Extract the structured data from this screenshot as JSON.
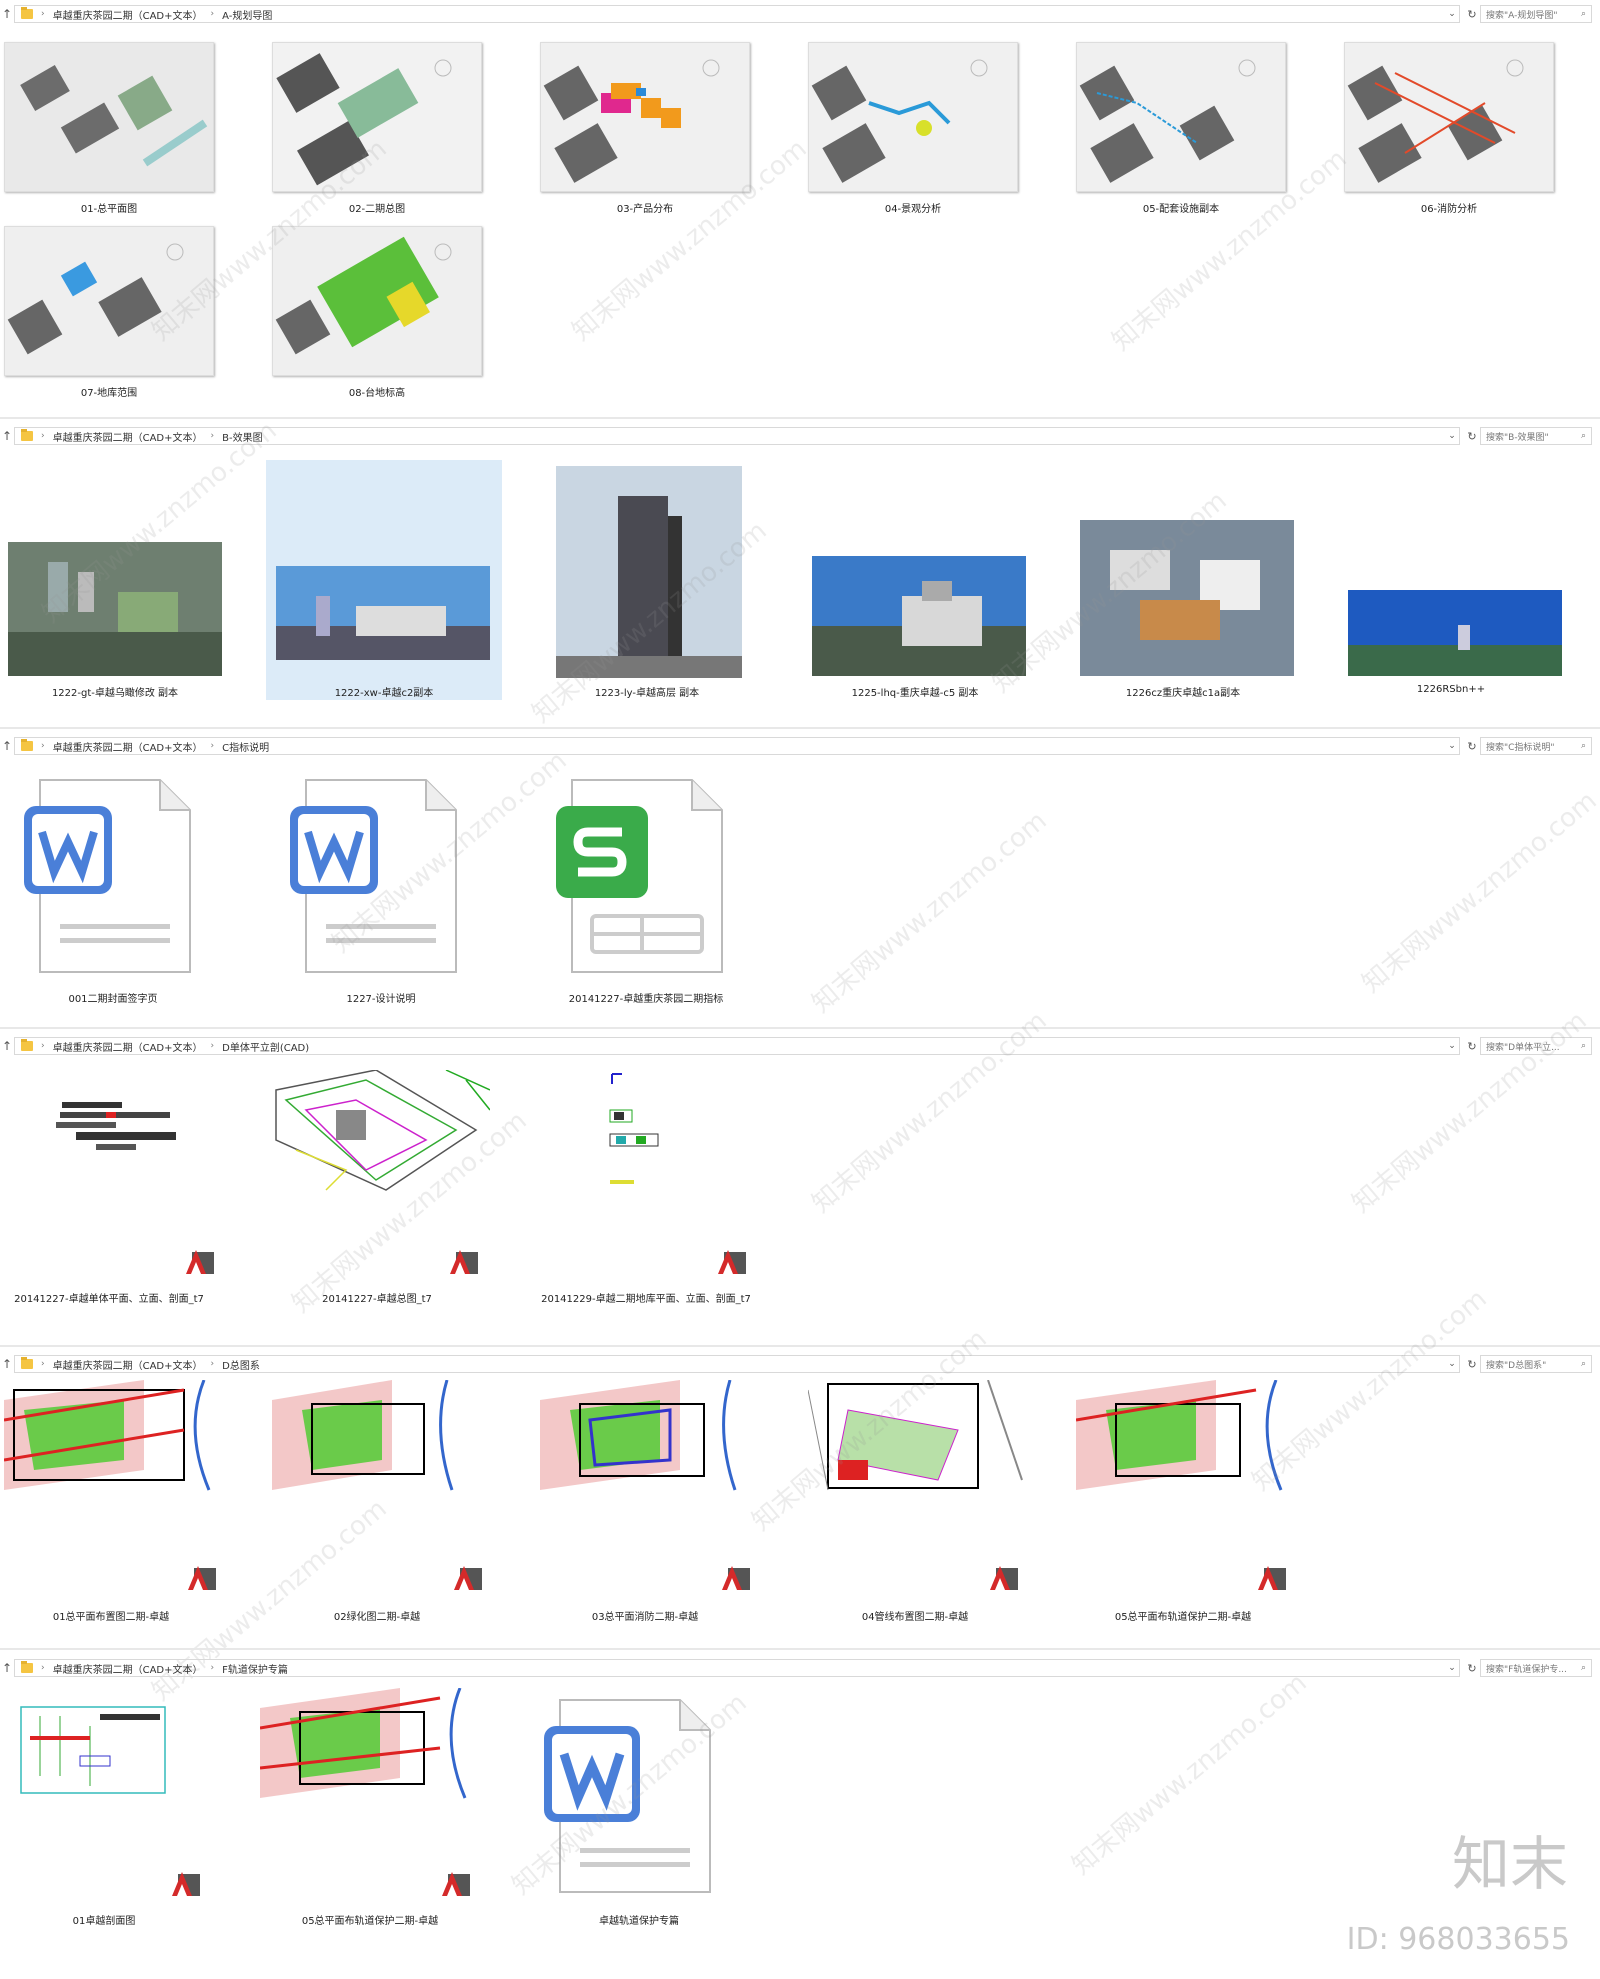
{
  "common": {
    "root": "卓越重庆茶园二期（CAD+文本）",
    "up_icon": "arrow-up-icon",
    "sep": "›",
    "drop": "⌄",
    "refresh": "↻",
    "search_glyph": "⌕"
  },
  "sections": [
    {
      "folder": "A-规划导图",
      "search": "搜索\"A-规划导图\"",
      "items": [
        "01-总平面图",
        "02-二期总图",
        "03-产品分布",
        "04-景观分析",
        "05-配套设施副本",
        "06-消防分析",
        "07-地库范围",
        "08-台地标高"
      ]
    },
    {
      "folder": "B-效果图",
      "search": "搜索\"B-效果图\"",
      "items": [
        "1222-gt-卓越乌瞰修改 副本",
        "1222-xw-卓越c2副本",
        "1223-ly-卓越高层 副本",
        "1225-lhq-重庆卓越-c5 副本",
        "1226cz重庆卓越c1a副本",
        "1226RSbn++"
      ]
    },
    {
      "folder": "C指标说明",
      "search": "搜索\"C指标说明\"",
      "items": [
        "001二期封面签字页",
        "1227-设计说明",
        "20141227-卓越重庆茶园二期指标"
      ]
    },
    {
      "folder": "D单体平立剖(CAD)",
      "search": "搜索\"D单体平立...",
      "items": [
        "20141227-卓越单体平面、立面、剖面_t7",
        "20141227-卓越总图_t7",
        "20141229-卓越二期地库平面、立面、剖面_t7"
      ]
    },
    {
      "folder": "D总图系",
      "search": "搜索\"D总图系\"",
      "items": [
        "01总平面布置图二期-卓越",
        "02绿化图二期-卓越",
        "03总平面消防二期-卓越",
        "04管线布置图二期-卓越",
        "05总平面布轨道保护二期-卓越"
      ]
    },
    {
      "folder": "F轨道保护专篇",
      "search": "搜索\"F轨道保护专...",
      "items": [
        "01卓越剖面图",
        "05总平面布轨道保护二期-卓越",
        "卓越轨道保护专篇"
      ]
    }
  ],
  "watermark": "知末网www.znzmo.com",
  "brand": "知末",
  "image_id": "ID: 968033655",
  "colors": {
    "word_blue": "#4a7fd8",
    "wps_green": "#3aab4a",
    "acad_red": "#d42a2a",
    "selected_bg": "#dcebf8"
  }
}
